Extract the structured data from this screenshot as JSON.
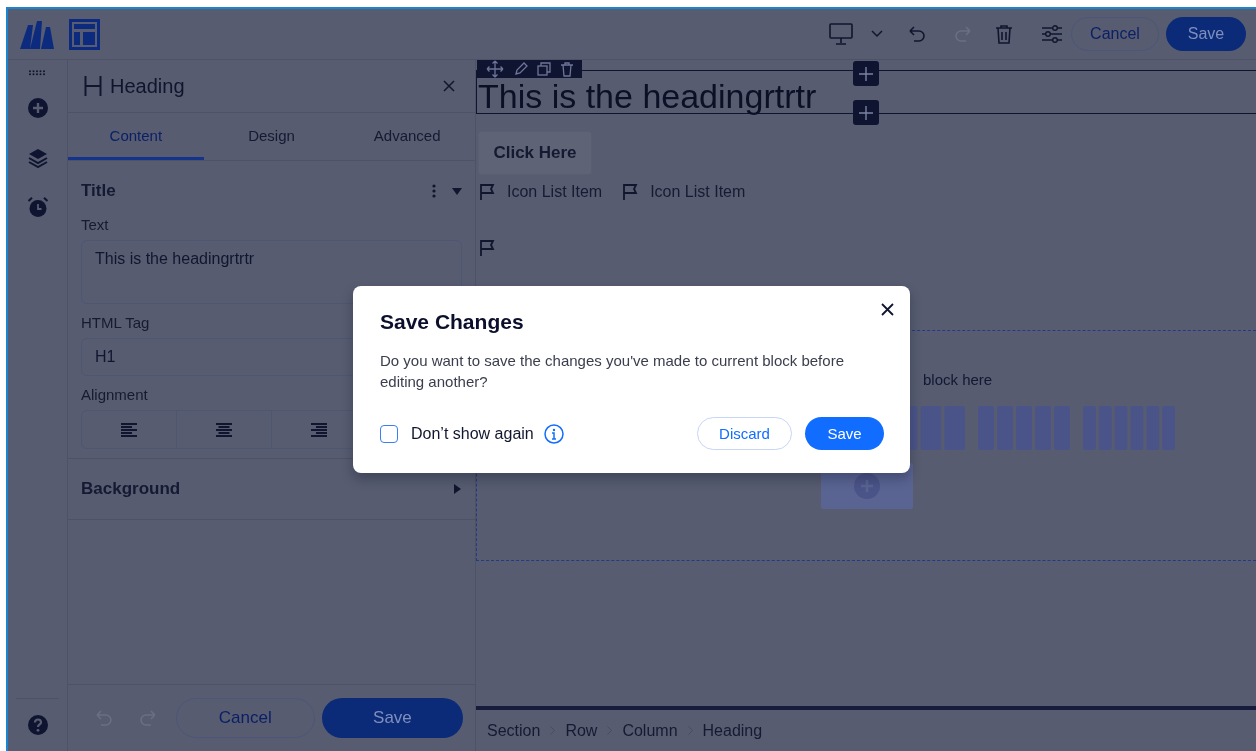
{
  "top_bar": {
    "undo": {
      "disabled": false
    },
    "redo": {
      "disabled": true
    },
    "cancel": "Cancel",
    "save": "Save"
  },
  "panel": {
    "title": "Heading",
    "tabs": [
      {
        "label": "Content",
        "selected": true
      },
      {
        "label": "Design",
        "selected": false
      },
      {
        "label": "Advanced",
        "selected": false
      }
    ],
    "section": {
      "title": "Title",
      "expanded": true
    },
    "text_field": {
      "label": "Text",
      "value": "This is the headingrtrtr"
    },
    "tag_field": {
      "label": "HTML Tag",
      "value": "H1"
    },
    "alignment": {
      "label": "Alignment"
    },
    "background": {
      "title": "Background",
      "expanded": false
    },
    "footer": {
      "undo": {
        "disabled": true
      },
      "redo": {
        "disabled": true
      },
      "cancel": "Cancel",
      "save": "Save"
    }
  },
  "canvas": {
    "heading": "This is the headingrtrtr",
    "button": "Click Here",
    "icon_list": [
      {
        "label": "Icon List Item"
      },
      {
        "label": "Icon List Item"
      }
    ],
    "drop_zone": {
      "text": "block here"
    },
    "breadcrumb": [
      "Section",
      "Row",
      "Column",
      "Heading"
    ]
  },
  "dialog": {
    "title": "Save Changes",
    "message": "Do you want to save the changes you've made to current block before editing another?",
    "checkbox": {
      "label": "Don’t show again",
      "checked": false
    },
    "discard": "Discard",
    "save": "Save"
  }
}
